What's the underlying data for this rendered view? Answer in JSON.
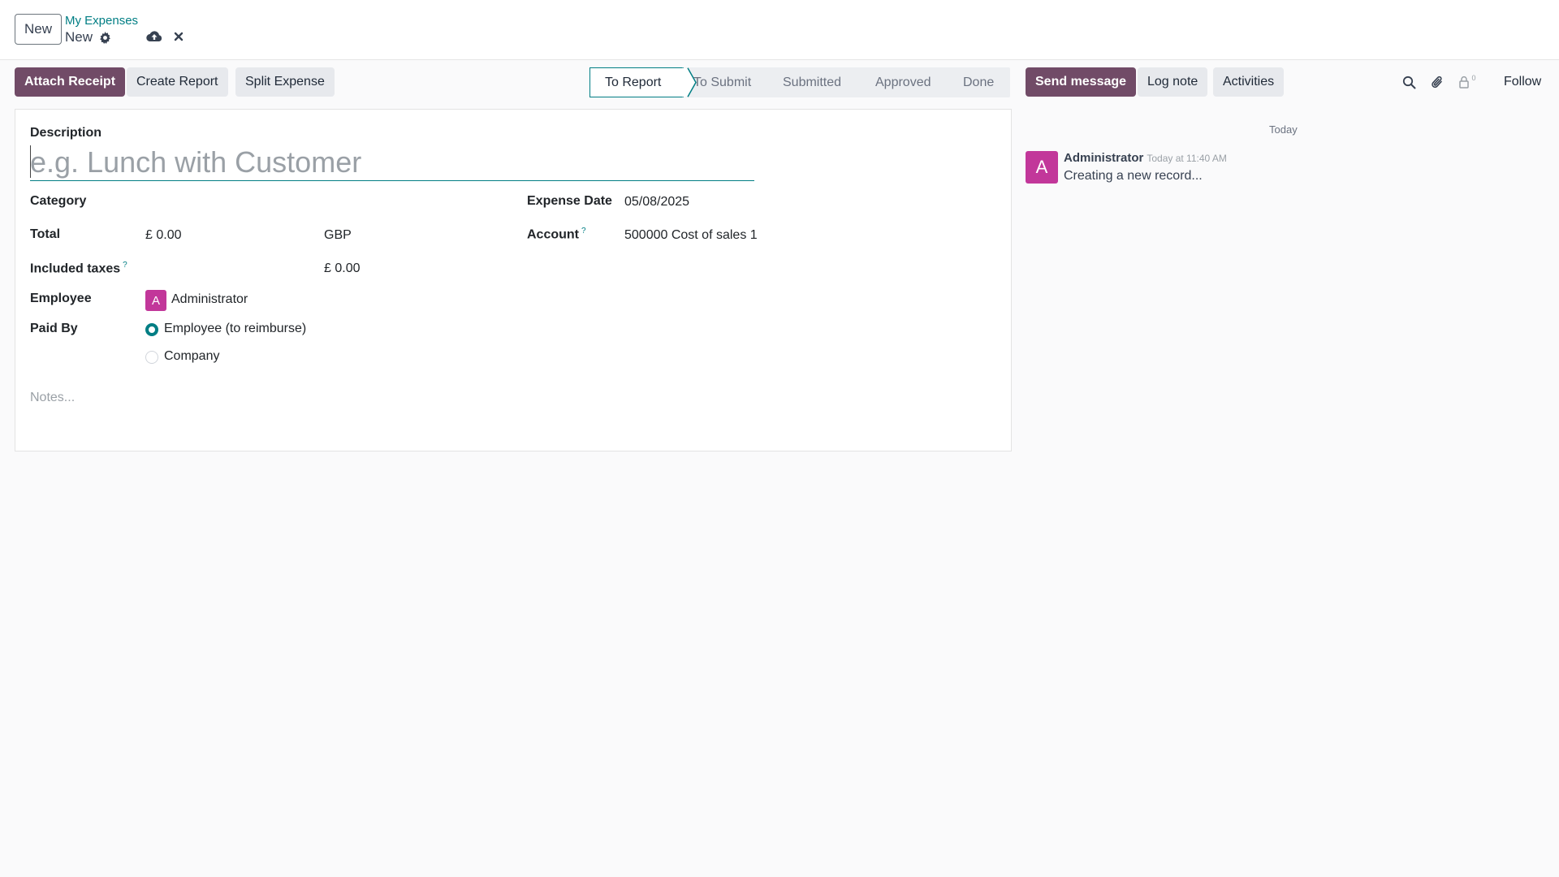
{
  "header": {
    "new_button": "New",
    "breadcrumb": "My Expenses",
    "record_title": "New",
    "icons": [
      "gear-icon",
      "cloud-upload-icon",
      "close-icon"
    ]
  },
  "actions": {
    "attach_receipt": "Attach Receipt",
    "create_report": "Create Report",
    "split_expense": "Split Expense"
  },
  "statusbar": {
    "stages": [
      "To Report",
      "To Submit",
      "Submitted",
      "Approved",
      "Done"
    ],
    "active": "To Report"
  },
  "chatter_buttons": {
    "send_message": "Send message",
    "log_note": "Log note",
    "activities": "Activities",
    "follower_count": "0",
    "follow": "Follow",
    "icons": [
      "search-icon",
      "paperclip-icon",
      "lock-icon"
    ]
  },
  "form": {
    "description_label": "Description",
    "description_placeholder": "e.g. Lunch with Customer",
    "category_label": "Category",
    "total_label": "Total",
    "total_value": "£ 0.00",
    "currency": "GBP",
    "included_taxes_label": "Included taxes",
    "included_taxes_value": "£ 0.00",
    "help_mark": "?",
    "employee_label": "Employee",
    "employee_initial": "A",
    "employee_name": "Administrator",
    "paid_by_label": "Paid By",
    "paid_by_options": [
      "Employee (to reimburse)",
      "Company"
    ],
    "paid_by_selected": "Employee (to reimburse)",
    "expense_date_label": "Expense Date",
    "expense_date_value": "05/08/2025",
    "account_label": "Account",
    "account_value": "500000 Cost of sales 1",
    "notes_placeholder": "Notes..."
  },
  "chatter": {
    "date_separator": "Today",
    "messages": [
      {
        "author_initial": "A",
        "author": "Administrator",
        "date": "Today at 11:40 AM",
        "body": "Creating a new record..."
      }
    ]
  },
  "colors": {
    "primary": "#714b67",
    "accent": "#017e84",
    "avatar": "#c2379a"
  }
}
